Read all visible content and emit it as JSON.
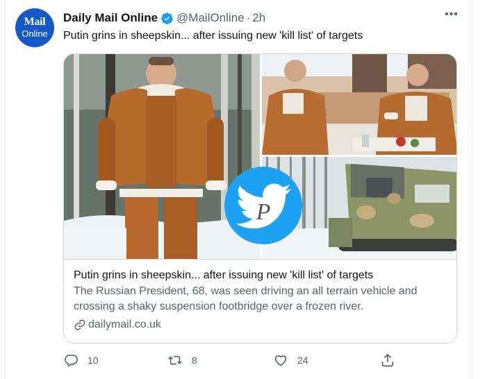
{
  "account": {
    "avatar_line1": "Mail",
    "avatar_line2": "Online",
    "name": "Daily Mail Online",
    "handle": "@MailOnline",
    "separator": "·",
    "time": "2h"
  },
  "tweet": {
    "text": "Putin grins in sheepskin... after issuing new 'kill list' of targets"
  },
  "card": {
    "title": "Putin grins in sheepskin... after issuing new 'kill list' of targets",
    "description": "The Russian President, 68, was seen driving an all terrain vehicle and crossing a shaky suspension footbridge over a frozen river.",
    "domain": "dailymail.co.uk"
  },
  "actions": {
    "reply_count": "10",
    "retweet_count": "8",
    "like_count": "24"
  },
  "overlay": {
    "badge_letter": "P"
  },
  "colors": {
    "accent": "#1da1f2",
    "verified": "#1d9bf0",
    "text_primary": "#0f1419",
    "text_secondary": "#536471",
    "avatar_bg": "#1357c8"
  },
  "icons": [
    "verified-badge-icon",
    "more-icon",
    "link-icon",
    "reply-icon",
    "retweet-icon",
    "like-icon",
    "share-icon",
    "twitter-bird-icon"
  ]
}
